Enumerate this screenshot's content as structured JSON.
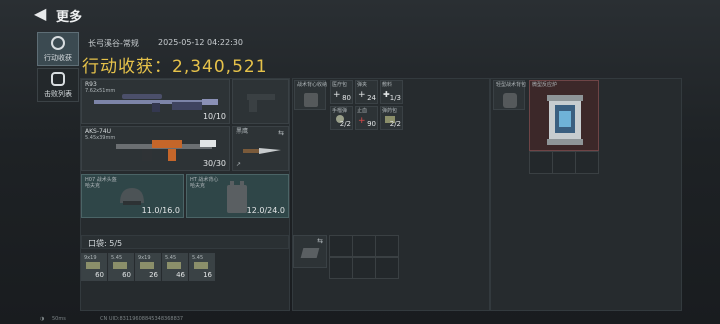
{
  "header": {
    "title": "更多"
  },
  "side_tabs": [
    {
      "label": "行动收获"
    },
    {
      "label": "击败列表"
    }
  ],
  "summary": {
    "map_mode": "长弓溪谷-常规",
    "datetime": "2025-05-12 04:22:30",
    "earnings": "行动收获：2,340,521"
  },
  "weapons": [
    {
      "name": "R93",
      "caliber": "7.62x51mm",
      "count": "10/10"
    },
    {
      "name": "AKS-74U",
      "caliber": "5.45x39mm",
      "count": "30/30"
    }
  ],
  "melee": {
    "name": "黑鹰"
  },
  "gear": [
    {
      "line1": "H07 战术头盔",
      "line2": "哈夫克",
      "durability": "11.0/16.0"
    },
    {
      "line1": "HT 战术背心",
      "line2": "哈夫克",
      "durability": "12.0/24.0"
    }
  ],
  "pocket": {
    "label": "口袋: 5/5"
  },
  "ammo": [
    {
      "caliber": "9x19",
      "count": "60"
    },
    {
      "caliber": "5.45",
      "count": "60"
    },
    {
      "caliber": "9x19",
      "count": "26"
    },
    {
      "caliber": "5.45",
      "count": "46"
    },
    {
      "caliber": "5.45",
      "count": "16"
    }
  ],
  "rig_label": "战术背心收纳",
  "consumables": [
    {
      "label": "医疗包",
      "count": "80"
    },
    {
      "label": "弹夹",
      "count": "24"
    },
    {
      "label": "敷料",
      "count": "1/3"
    },
    {
      "label": "手榴弹",
      "count": "2/2"
    },
    {
      "label": "止血",
      "count": "90"
    },
    {
      "label": "弹药包",
      "count": "2/2"
    }
  ],
  "backpack_label": "轻型战术背包",
  "loot": {
    "label": "微型反应炉"
  },
  "statusbar": {
    "ping": "50ms",
    "uid": "CN UID:83119608845348368837"
  }
}
